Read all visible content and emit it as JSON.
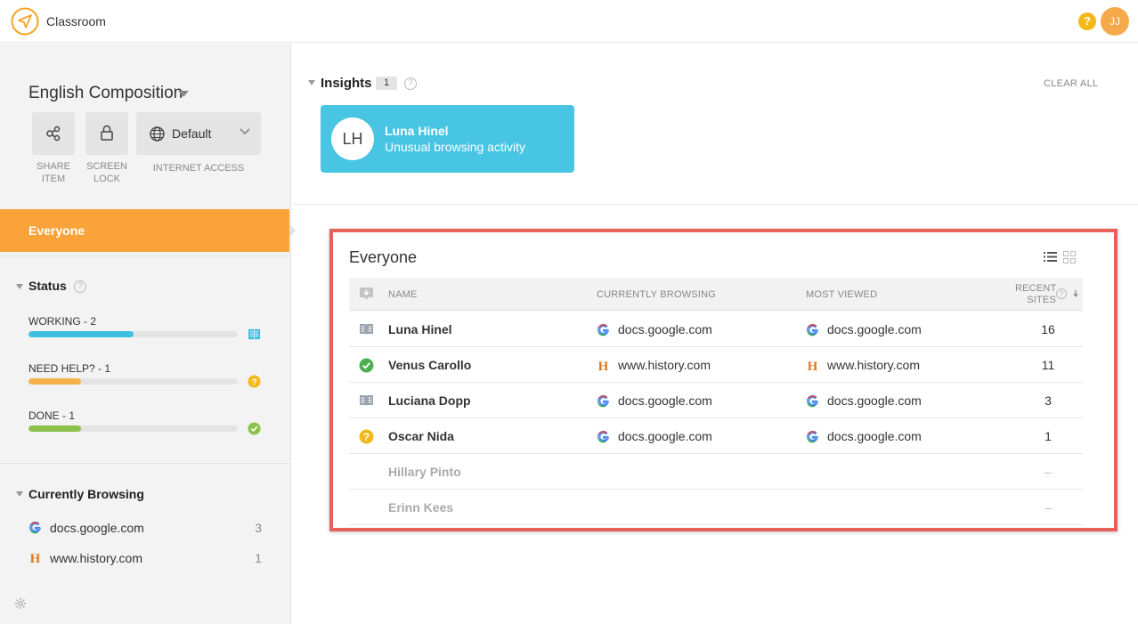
{
  "app": {
    "title": "Classroom",
    "user_initials": "JJ",
    "help_glyph": "?"
  },
  "sidebar": {
    "class_name": "English Composition",
    "tools": {
      "share_label": "SHARE ITEM",
      "lock_label": "SCREEN LOCK",
      "internet_value": "Default",
      "internet_label": "INTERNET ACCESS"
    },
    "selected_group": "Everyone",
    "status": {
      "heading": "Status",
      "items": [
        {
          "label": "WORKING - 2",
          "fraction": 0.5,
          "color": "#3cbfe0",
          "icon": "book-icon"
        },
        {
          "label": "NEED HELP? - 1",
          "fraction": 0.25,
          "color": "#f5b24a",
          "icon": "help-icon"
        },
        {
          "label": "DONE - 1",
          "fraction": 0.25,
          "color": "#8bc34a",
          "icon": "check-icon"
        }
      ]
    },
    "browsing": {
      "heading": "Currently Browsing",
      "sites": [
        {
          "name": "docs.google.com",
          "count": "3",
          "icon": "google-icon"
        },
        {
          "name": "www.history.com",
          "count": "1",
          "icon": "history-icon"
        }
      ]
    }
  },
  "insights": {
    "heading": "Insights",
    "count": "1",
    "clear_label": "CLEAR ALL",
    "card": {
      "initials": "LH",
      "name": "Luna Hinel",
      "description": "Unusual browsing activity"
    }
  },
  "roster": {
    "title": "Everyone",
    "columns": {
      "name": "NAME",
      "currently": "CURRENTLY BROWSING",
      "most": "MOST VIEWED",
      "recent_line1": "RECENT",
      "recent_line2": "SITES"
    },
    "rows": [
      {
        "name": "Luna Hinel",
        "status_icon": "book-icon",
        "current": "docs.google.com",
        "current_icon": "google-icon",
        "most": "docs.google.com",
        "most_icon": "google-icon",
        "recent": "16"
      },
      {
        "name": "Venus Carollo",
        "status_icon": "check-icon",
        "current": "www.history.com",
        "current_icon": "history-icon",
        "most": "www.history.com",
        "most_icon": "history-icon",
        "recent": "11"
      },
      {
        "name": "Luciana Dopp",
        "status_icon": "book-icon",
        "current": "docs.google.com",
        "current_icon": "google-icon",
        "most": "docs.google.com",
        "most_icon": "google-icon",
        "recent": "3"
      },
      {
        "name": "Oscar Nida",
        "status_icon": "help-icon",
        "current": "docs.google.com",
        "current_icon": "google-icon",
        "most": "docs.google.com",
        "most_icon": "google-icon",
        "recent": "1"
      },
      {
        "name": "Hillary Pinto",
        "recent": "–"
      },
      {
        "name": "Erinn Kees",
        "recent": "–"
      }
    ]
  }
}
